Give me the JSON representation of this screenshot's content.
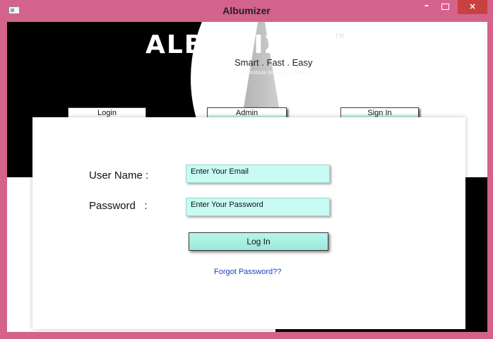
{
  "window": {
    "title": "Albumizer",
    "minimize_glyph": "–",
    "close_glyph": "×"
  },
  "logo": {
    "name": "ALBUMIZER",
    "tm": "TM",
    "tagline": "Smart . Fast . Easy",
    "subtagline": "A photobook designing software"
  },
  "tabs": [
    {
      "label": "Login"
    },
    {
      "label": "Admin"
    },
    {
      "label": "Sign In"
    }
  ],
  "form": {
    "username_label": "User Name :",
    "password_label": "Password   :",
    "username_placeholder": "Enter Your Email",
    "password_placeholder": "Enter Your Password",
    "login_button": "Log In",
    "forgot_link": "Forgot Password??"
  },
  "colors": {
    "titlebar": "#d4638c",
    "close_button": "#c8403f",
    "input_fill": "#c8fbf4",
    "link": "#1f3fbf"
  },
  "icons": [
    "app-icon",
    "minimize-icon",
    "maximize-icon",
    "close-icon"
  ]
}
